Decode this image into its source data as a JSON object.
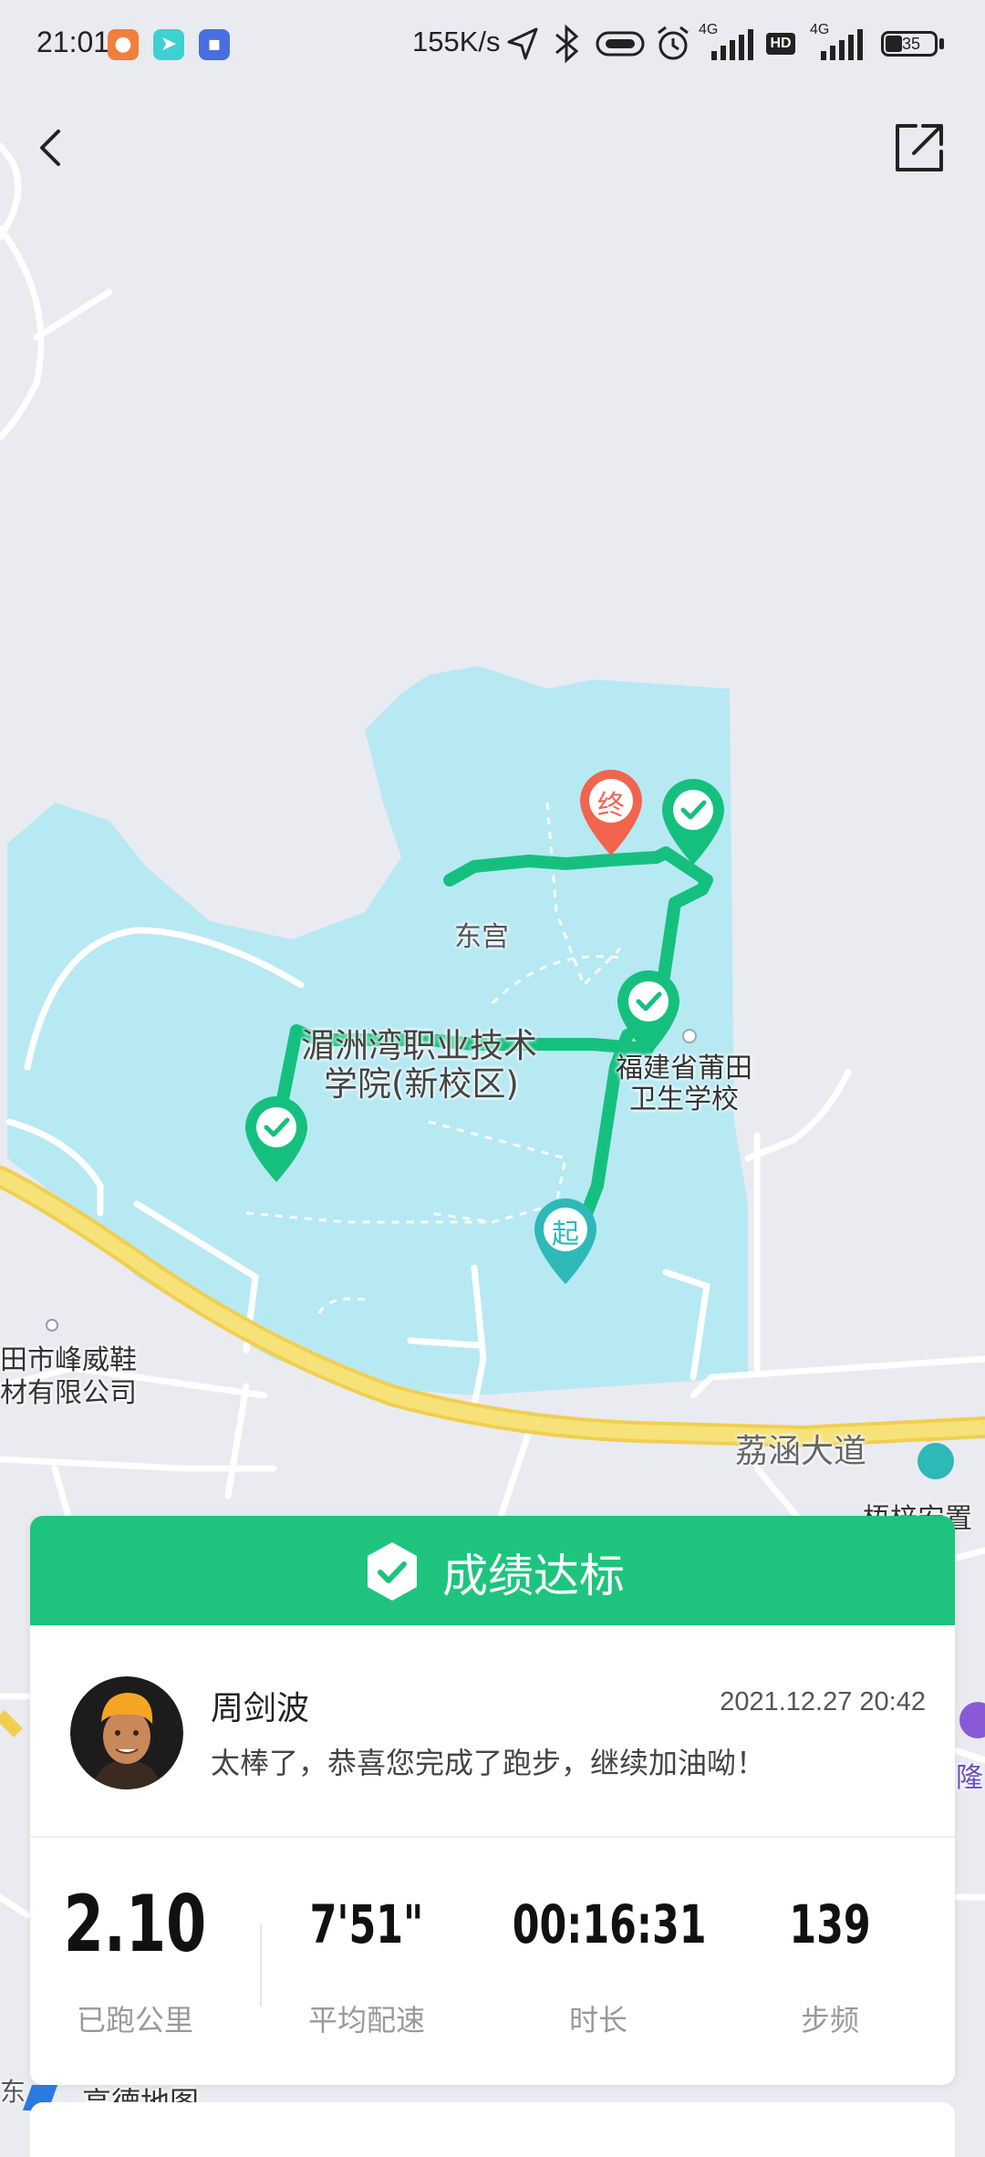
{
  "status_bar": {
    "time": "21:01",
    "network_speed": "155K/s",
    "battery": "35",
    "network_1": "4G",
    "network_2": "4G",
    "hd": "HD"
  },
  "map": {
    "labels": {
      "donggong": "东宫",
      "campus_line1": "湄洲湾职业技术",
      "campus_line2": "学院(新校区)",
      "school_line1": "福建省莆田",
      "school_line2": "卫生学校",
      "company_line1": "田市峰威鞋",
      "company_line2": "材有限公司",
      "road": "荔涵大道",
      "poi_right": "梧梓安置",
      "poi_right2": "隆",
      "bottom_left": "东",
      "amap": "高德地图"
    },
    "markers": {
      "start": "起",
      "end": "终"
    }
  },
  "result_card": {
    "banner_title": "成绩达标",
    "user_name": "周剑波",
    "datetime": "2021.12.27 20:42",
    "message": "太棒了，恭喜您完成了跑步，继续加油呦！",
    "stats": [
      {
        "value": "2.10",
        "label": "已跑公里"
      },
      {
        "value": "7'51\"",
        "label": "平均配速"
      },
      {
        "value": "00:16:31",
        "label": "时长"
      },
      {
        "value": "139",
        "label": "步频"
      }
    ]
  },
  "colors": {
    "accent": "#1ec47e",
    "route": "#15c07f",
    "water": "#b7e9f3",
    "end_marker": "#f2644e",
    "start_marker": "#2eb8b8",
    "road_main": "#f5dc64"
  }
}
